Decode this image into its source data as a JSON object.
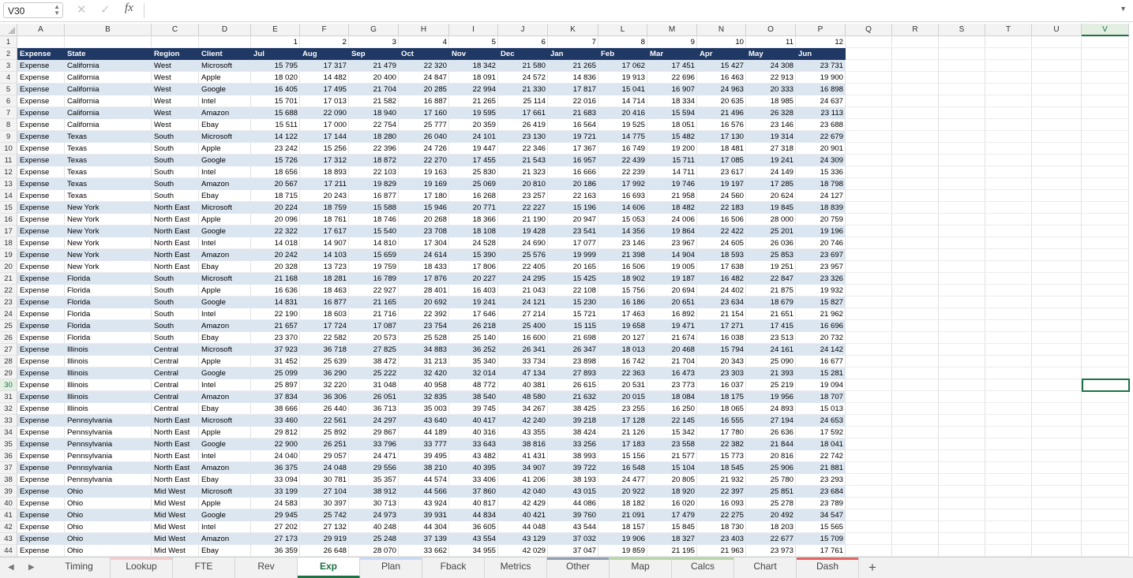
{
  "formula_bar": {
    "name_box": "V30",
    "cancel_glyph": "✕",
    "confirm_glyph": "✓",
    "fx_label": "fx",
    "formula": ""
  },
  "columns": [
    "A",
    "B",
    "C",
    "D",
    "E",
    "F",
    "G",
    "H",
    "I",
    "J",
    "K",
    "L",
    "M",
    "N",
    "O",
    "P",
    "Q",
    "R",
    "S",
    "T",
    "U",
    "V"
  ],
  "selected_column": "V",
  "selected_row": 30,
  "row1_numbers": [
    "1",
    "2",
    "3",
    "4",
    "5",
    "6",
    "7",
    "8",
    "9",
    "10",
    "11",
    "12"
  ],
  "header_row": [
    "Expense",
    "State",
    "Region",
    "Client",
    "Jul",
    "Aug",
    "Sep",
    "Oct",
    "Nov",
    "Dec",
    "Jan",
    "Feb",
    "Mar",
    "Apr",
    "May",
    "Jun"
  ],
  "rows": [
    [
      "Expense",
      "California",
      "West",
      "Microsoft",
      "15 795",
      "17 317",
      "21 479",
      "22 320",
      "18 342",
      "21 580",
      "21 265",
      "17 062",
      "17 451",
      "15 427",
      "24 308",
      "23 731"
    ],
    [
      "Expense",
      "California",
      "West",
      "Apple",
      "18 020",
      "14 482",
      "20 400",
      "24 847",
      "18 091",
      "24 572",
      "14 836",
      "19 913",
      "22 696",
      "16 463",
      "22 913",
      "19 900"
    ],
    [
      "Expense",
      "California",
      "West",
      "Google",
      "16 405",
      "17 495",
      "21 704",
      "20 285",
      "22 994",
      "21 330",
      "17 817",
      "15 041",
      "16 907",
      "24 963",
      "20 333",
      "16 898"
    ],
    [
      "Expense",
      "California",
      "West",
      "Intel",
      "15 701",
      "17 013",
      "21 582",
      "16 887",
      "21 265",
      "25 114",
      "22 016",
      "14 714",
      "18 334",
      "20 635",
      "18 985",
      "24 637"
    ],
    [
      "Expense",
      "California",
      "West",
      "Amazon",
      "15 688",
      "22 090",
      "18 940",
      "17 160",
      "19 595",
      "17 661",
      "21 683",
      "20 416",
      "15 594",
      "21 496",
      "26 328",
      "23 113"
    ],
    [
      "Expense",
      "California",
      "West",
      "Ebay",
      "15 511",
      "17 000",
      "22 754",
      "25 777",
      "20 359",
      "26 419",
      "16 564",
      "19 525",
      "18 051",
      "16 576",
      "23 146",
      "23 688"
    ],
    [
      "Expense",
      "Texas",
      "South",
      "Microsoft",
      "14 122",
      "17 144",
      "18 280",
      "26 040",
      "24 101",
      "23 130",
      "19 721",
      "14 775",
      "15 482",
      "17 130",
      "19 314",
      "22 679"
    ],
    [
      "Expense",
      "Texas",
      "South",
      "Apple",
      "23 242",
      "15 256",
      "22 396",
      "24 726",
      "19 447",
      "22 346",
      "17 367",
      "16 749",
      "19 200",
      "18 481",
      "27 318",
      "20 901"
    ],
    [
      "Expense",
      "Texas",
      "South",
      "Google",
      "15 726",
      "17 312",
      "18 872",
      "22 270",
      "17 455",
      "21 543",
      "16 957",
      "22 439",
      "15 711",
      "17 085",
      "19 241",
      "24 309"
    ],
    [
      "Expense",
      "Texas",
      "South",
      "Intel",
      "18 656",
      "18 893",
      "22 103",
      "19 163",
      "25 830",
      "21 323",
      "16 666",
      "22 239",
      "14 711",
      "23 617",
      "24 149",
      "15 336"
    ],
    [
      "Expense",
      "Texas",
      "South",
      "Amazon",
      "20 567",
      "17 211",
      "19 829",
      "19 169",
      "25 069",
      "20 810",
      "20 186",
      "17 992",
      "19 746",
      "19 197",
      "17 285",
      "18 798"
    ],
    [
      "Expense",
      "Texas",
      "South",
      "Ebay",
      "18 715",
      "20 243",
      "16 877",
      "17 180",
      "16 268",
      "23 257",
      "22 163",
      "16 693",
      "21 958",
      "24 560",
      "20 624",
      "24 127"
    ],
    [
      "Expense",
      "New York",
      "North East",
      "Microsoft",
      "20 224",
      "18 759",
      "15 588",
      "15 946",
      "20 771",
      "22 227",
      "15 196",
      "14 606",
      "18 482",
      "22 183",
      "19 845",
      "18 839"
    ],
    [
      "Expense",
      "New York",
      "North East",
      "Apple",
      "20 096",
      "18 761",
      "18 746",
      "20 268",
      "18 366",
      "21 190",
      "20 947",
      "15 053",
      "24 006",
      "16 506",
      "28 000",
      "20 759"
    ],
    [
      "Expense",
      "New York",
      "North East",
      "Google",
      "22 322",
      "17 617",
      "15 540",
      "23 708",
      "18 108",
      "19 428",
      "23 541",
      "14 356",
      "19 864",
      "22 422",
      "25 201",
      "19 196"
    ],
    [
      "Expense",
      "New York",
      "North East",
      "Intel",
      "14 018",
      "14 907",
      "14 810",
      "17 304",
      "24 528",
      "24 690",
      "17 077",
      "23 146",
      "23 967",
      "24 605",
      "26 036",
      "20 746"
    ],
    [
      "Expense",
      "New York",
      "North East",
      "Amazon",
      "20 242",
      "14 103",
      "15 659",
      "24 614",
      "15 390",
      "25 576",
      "19 999",
      "21 398",
      "14 904",
      "18 593",
      "25 853",
      "23 697"
    ],
    [
      "Expense",
      "New York",
      "North East",
      "Ebay",
      "20 328",
      "13 723",
      "19 759",
      "18 433",
      "17 806",
      "22 405",
      "20 165",
      "16 506",
      "19 005",
      "17 638",
      "19 251",
      "23 957"
    ],
    [
      "Expense",
      "Florida",
      "South",
      "Microsoft",
      "21 168",
      "18 281",
      "16 789",
      "17 876",
      "20 227",
      "24 295",
      "15 425",
      "18 902",
      "19 187",
      "16 482",
      "22 847",
      "23 326"
    ],
    [
      "Expense",
      "Florida",
      "South",
      "Apple",
      "16 636",
      "18 463",
      "22 927",
      "28 401",
      "16 403",
      "21 043",
      "22 108",
      "15 756",
      "20 694",
      "24 402",
      "21 875",
      "19 932"
    ],
    [
      "Expense",
      "Florida",
      "South",
      "Google",
      "14 831",
      "16 877",
      "21 165",
      "20 692",
      "19 241",
      "24 121",
      "15 230",
      "16 186",
      "20 651",
      "23 634",
      "18 679",
      "15 827"
    ],
    [
      "Expense",
      "Florida",
      "South",
      "Intel",
      "22 190",
      "18 603",
      "21 716",
      "22 392",
      "17 646",
      "27 214",
      "15 721",
      "17 463",
      "16 892",
      "21 154",
      "21 651",
      "21 962"
    ],
    [
      "Expense",
      "Florida",
      "South",
      "Amazon",
      "21 657",
      "17 724",
      "17 087",
      "23 754",
      "26 218",
      "25 400",
      "15 115",
      "19 658",
      "19 471",
      "17 271",
      "17 415",
      "16 696"
    ],
    [
      "Expense",
      "Florida",
      "South",
      "Ebay",
      "23 370",
      "22 582",
      "20 573",
      "25 528",
      "25 140",
      "16 600",
      "21 698",
      "20 127",
      "21 674",
      "16 038",
      "23 513",
      "20 732"
    ],
    [
      "Expense",
      "Illinois",
      "Central",
      "Microsoft",
      "37 923",
      "36 718",
      "27 825",
      "34 883",
      "36 252",
      "26 341",
      "26 347",
      "18 013",
      "20 468",
      "15 794",
      "24 161",
      "24 142"
    ],
    [
      "Expense",
      "Illinois",
      "Central",
      "Apple",
      "31 452",
      "25 639",
      "38 472",
      "31 213",
      "35 340",
      "33 734",
      "23 898",
      "16 742",
      "21 704",
      "20 343",
      "25 090",
      "16 677"
    ],
    [
      "Expense",
      "Illinois",
      "Central",
      "Google",
      "25 099",
      "36 290",
      "25 222",
      "32 420",
      "32 014",
      "47 134",
      "27 893",
      "22 363",
      "16 473",
      "23 303",
      "21 393",
      "15 281"
    ],
    [
      "Expense",
      "Illinois",
      "Central",
      "Intel",
      "25 897",
      "32 220",
      "31 048",
      "40 958",
      "48 772",
      "40 381",
      "26 615",
      "20 531",
      "23 773",
      "16 037",
      "25 219",
      "19 094"
    ],
    [
      "Expense",
      "Illinois",
      "Central",
      "Amazon",
      "37 834",
      "36 306",
      "26 051",
      "32 835",
      "38 540",
      "48 580",
      "21 632",
      "20 015",
      "18 084",
      "18 175",
      "19 956",
      "18 707"
    ],
    [
      "Expense",
      "Illinois",
      "Central",
      "Ebay",
      "38 666",
      "26 440",
      "36 713",
      "35 003",
      "39 745",
      "34 267",
      "38 425",
      "23 255",
      "16 250",
      "18 065",
      "24 893",
      "15 013"
    ],
    [
      "Expense",
      "Pennsylvania",
      "North East",
      "Microsoft",
      "33 460",
      "22 561",
      "24 297",
      "43 640",
      "40 417",
      "42 240",
      "39 218",
      "17 128",
      "22 145",
      "16 555",
      "27 194",
      "24 653"
    ],
    [
      "Expense",
      "Pennsylvania",
      "North East",
      "Apple",
      "29 812",
      "25 892",
      "29 867",
      "44 189",
      "40 316",
      "43 355",
      "38 424",
      "21 126",
      "15 342",
      "17 780",
      "26 636",
      "17 592"
    ],
    [
      "Expense",
      "Pennsylvania",
      "North East",
      "Google",
      "22 900",
      "26 251",
      "33 796",
      "33 777",
      "33 643",
      "38 816",
      "33 256",
      "17 183",
      "23 558",
      "22 382",
      "21 844",
      "18 041"
    ],
    [
      "Expense",
      "Pennsylvania",
      "North East",
      "Intel",
      "24 040",
      "29 057",
      "24 471",
      "39 495",
      "43 482",
      "41 431",
      "38 993",
      "15 156",
      "21 577",
      "15 773",
      "20 816",
      "22 742"
    ],
    [
      "Expense",
      "Pennsylvania",
      "North East",
      "Amazon",
      "36 375",
      "24 048",
      "29 556",
      "38 210",
      "40 395",
      "34 907",
      "39 722",
      "16 548",
      "15 104",
      "18 545",
      "25 906",
      "21 881"
    ],
    [
      "Expense",
      "Pennsylvania",
      "North East",
      "Ebay",
      "33 094",
      "30 781",
      "35 357",
      "44 574",
      "33 406",
      "41 206",
      "38 193",
      "24 477",
      "20 805",
      "21 932",
      "25 780",
      "23 293"
    ],
    [
      "Expense",
      "Ohio",
      "Mid West",
      "Microsoft",
      "33 199",
      "27 104",
      "38 912",
      "44 566",
      "37 860",
      "42 040",
      "43 015",
      "20 922",
      "18 920",
      "22 397",
      "25 851",
      "23 684"
    ],
    [
      "Expense",
      "Ohio",
      "Mid West",
      "Apple",
      "24 583",
      "30 397",
      "30 713",
      "43 924",
      "40 817",
      "42 429",
      "44 086",
      "18 182",
      "16 020",
      "16 093",
      "25 278",
      "23 789"
    ],
    [
      "Expense",
      "Ohio",
      "Mid West",
      "Google",
      "29 945",
      "25 742",
      "24 973",
      "39 931",
      "44 834",
      "40 421",
      "39 760",
      "21 091",
      "17 479",
      "22 275",
      "20 492",
      "34 547"
    ],
    [
      "Expense",
      "Ohio",
      "Mid West",
      "Intel",
      "27 202",
      "27 132",
      "40 248",
      "44 304",
      "36 605",
      "44 048",
      "43 544",
      "18 157",
      "15 845",
      "18 730",
      "18 203",
      "15 565"
    ],
    [
      "Expense",
      "Ohio",
      "Mid West",
      "Amazon",
      "27 173",
      "29 919",
      "25 248",
      "37 139",
      "43 554",
      "43 129",
      "37 032",
      "19 906",
      "18 327",
      "23 403",
      "22 677",
      "15 709"
    ],
    [
      "Expense",
      "Ohio",
      "Mid West",
      "Ebay",
      "36 359",
      "26 648",
      "28 070",
      "33 662",
      "34 955",
      "42 029",
      "37 047",
      "19 859",
      "21 195",
      "21 963",
      "23 973",
      "17 761"
    ]
  ],
  "band_pattern": [
    1,
    0,
    1,
    0,
    1,
    0
  ],
  "sheet_nav": {
    "prev": "◀",
    "next": "▶",
    "add": "+"
  },
  "sheet_tabs": [
    {
      "label": "Timing",
      "stripe": ""
    },
    {
      "label": "Lookup",
      "stripe": "#f4cccc"
    },
    {
      "label": "FTE",
      "stripe": ""
    },
    {
      "label": "Rev",
      "stripe": ""
    },
    {
      "label": "Exp",
      "stripe": "",
      "active": true
    },
    {
      "label": "Plan",
      "stripe": "#c9daf8"
    },
    {
      "label": "Fback",
      "stripe": ""
    },
    {
      "label": "Metrics",
      "stripe": ""
    },
    {
      "label": "Other",
      "stripe": "#8e9fb3"
    },
    {
      "label": "Map",
      "stripe": "#b6d7a8"
    },
    {
      "label": "Calcs",
      "stripe": "#b6d7a8"
    },
    {
      "label": "Chart",
      "stripe": ""
    },
    {
      "label": "Dash",
      "stripe": "#e06666"
    }
  ]
}
